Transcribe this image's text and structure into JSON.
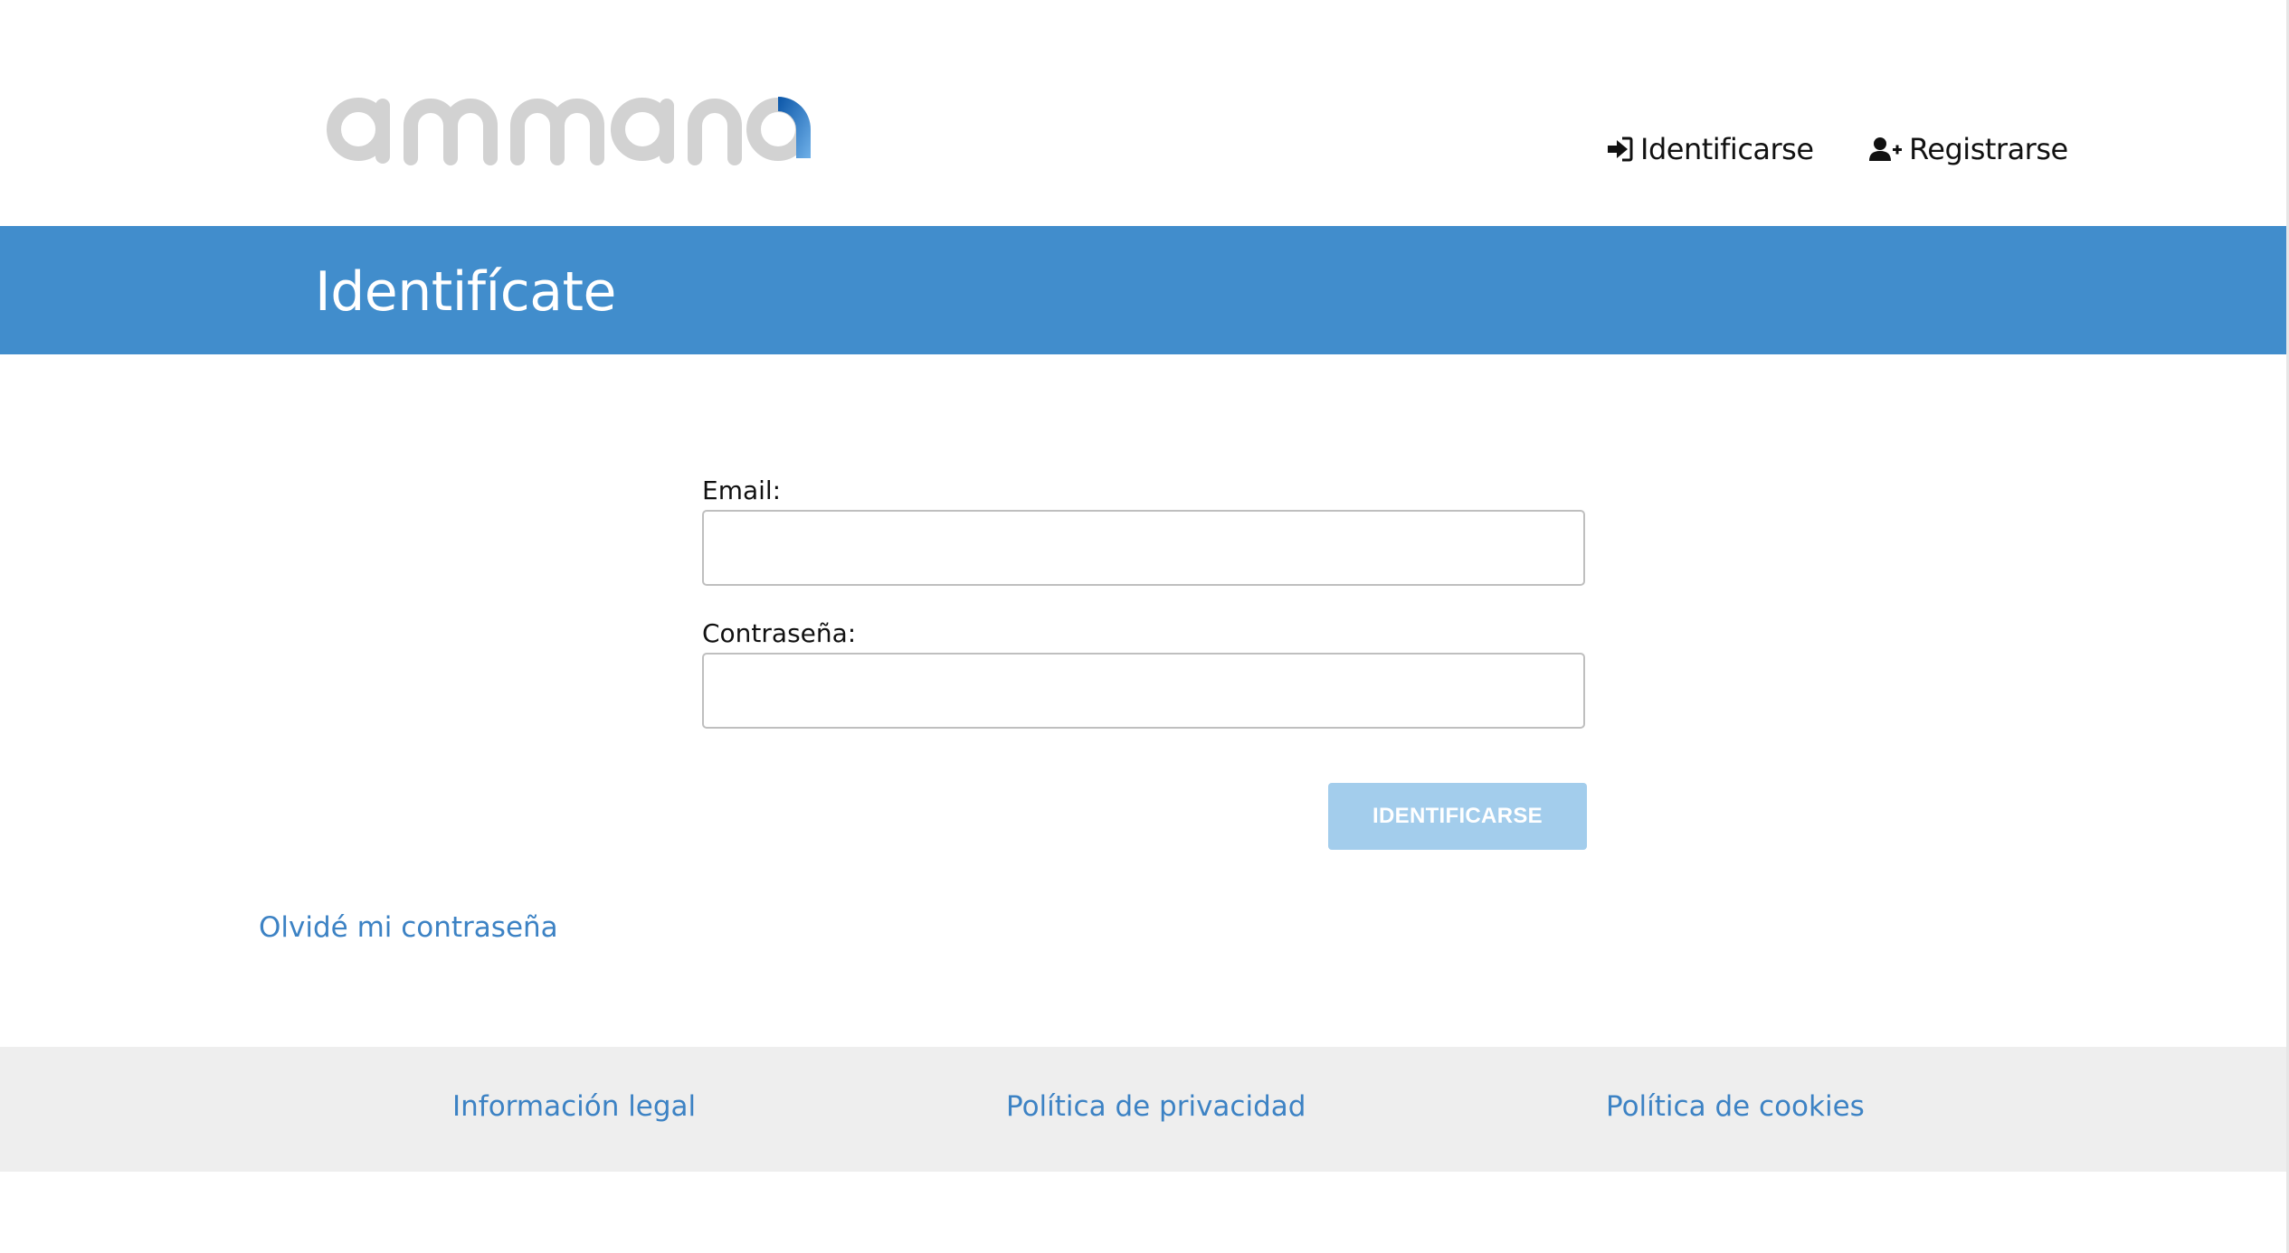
{
  "header": {
    "logo_text": "ammana",
    "nav": {
      "login_label": "Identificarse",
      "register_label": "Registrarse",
      "login_icon": "sign-in-icon",
      "register_icon": "user-plus-icon"
    }
  },
  "banner": {
    "title": "Identifícate",
    "color": "#418dcc"
  },
  "form": {
    "email_label": "Email:",
    "email_value": "",
    "password_label": "Contraseña:",
    "password_value": "",
    "submit_label": "IDENTIFICARSE",
    "submit_color": "#a3cdec"
  },
  "forgot_link": "Olvidé mi contraseña",
  "footer": {
    "links": [
      "Información legal",
      "Política de privacidad",
      "Política de cookies"
    ],
    "link_color": "#3c82c4"
  }
}
